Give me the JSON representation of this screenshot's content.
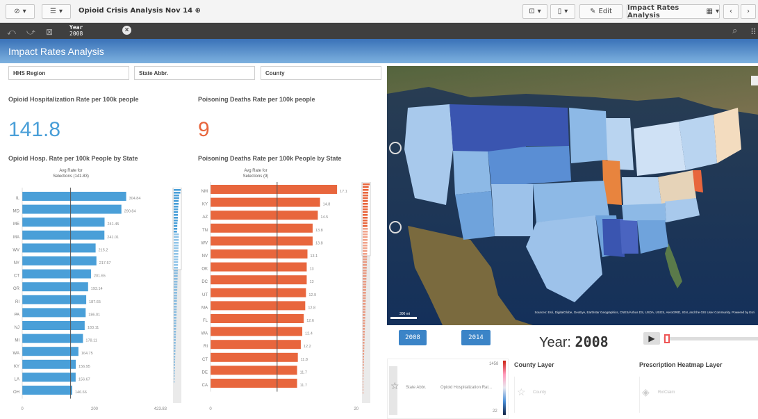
{
  "app": {
    "title": "Opioid Crisis Analysis Nov 14",
    "sheet_title": "Impact Rates Analysis"
  },
  "toolbar": {
    "edit_label": "Edit",
    "sheet_selector": "Impact Rates Analysis"
  },
  "selection": {
    "field": "Year",
    "value": "2008"
  },
  "filters": [
    {
      "label": "HHS Region"
    },
    {
      "label": "State Abbr."
    },
    {
      "label": "County"
    }
  ],
  "kpis": {
    "hosp": {
      "title": "Opioid Hospitalization Rate per 100k people",
      "value": "141.8",
      "color": "#4a9fd8"
    },
    "pois": {
      "title": "Poisoning Deaths Rate per 100k people",
      "value": "9",
      "color": "#e8663d"
    }
  },
  "chart_data": [
    {
      "type": "bar",
      "orientation": "horizontal",
      "title": "Opioid Hosp. Rate per 100k People by State",
      "reference_label": "Avg Rate for Selections (141.83)",
      "reference_value": 141.83,
      "categories": [
        "IL",
        "MD",
        "ME",
        "MA",
        "WV",
        "NY",
        "CT",
        "OR",
        "RI",
        "PA",
        "NJ",
        "MI",
        "WA",
        "KY",
        "LA",
        "OH"
      ],
      "values": [
        304.84,
        290.84,
        241.45,
        241.01,
        215.2,
        217.57,
        201.65,
        193.14,
        187.65,
        186.01,
        183.11,
        178.11,
        164.75,
        156.95,
        156.67,
        146.66
      ],
      "value_labels": [
        "304.84",
        "290.84",
        "241.45",
        "241.01",
        "215.2",
        "217.57",
        "201.65",
        "193.14",
        "187.65",
        "186.01",
        "183.11",
        "178.11",
        "164.75",
        "156.95",
        "156.67",
        "146.66"
      ],
      "xlim": [
        0,
        423.83
      ],
      "xticks": [
        "0",
        "200",
        "423.83"
      ],
      "color": "#4a9fd8"
    },
    {
      "type": "bar",
      "orientation": "horizontal",
      "title": "Poisoning Deaths Rate per 100k People by State",
      "reference_label": "Avg Rate for Selections (9)",
      "reference_value": 9,
      "categories": [
        "NM",
        "KY",
        "AZ",
        "TN",
        "WV",
        "NV",
        "OK",
        "DC",
        "UT",
        "MA",
        "FL",
        "WA",
        "RI",
        "CT",
        "DE",
        "CA"
      ],
      "values": [
        17.1,
        14.8,
        14.5,
        13.8,
        13.8,
        13.1,
        13,
        13,
        12.9,
        12.8,
        12.6,
        12.4,
        12.2,
        11.8,
        11.7,
        11.7
      ],
      "value_labels": [
        "17.1",
        "14.8",
        "14.5",
        "13.8",
        "13.8",
        "13.1",
        "13",
        "13",
        "12.9",
        "12.8",
        "12.6",
        "12.4",
        "12.2",
        "11.8",
        "11.7",
        "11.7"
      ],
      "xlim": [
        0,
        20
      ],
      "xticks": [
        "0",
        "20"
      ],
      "color": "#e8663d"
    }
  ],
  "map": {
    "attribution": "Sources: Esri, DigitalGlobe, GeoEye, Earthstar Geographics, CNES/Airbus DS, USDA, USGS, AeroGRID, IGN, and the GIS User Community. Powered by Esri",
    "scale": "300 mi"
  },
  "years": {
    "start": "2008",
    "end": "2014",
    "current_label": "Year:",
    "current": "2008"
  },
  "legend": {
    "max": "1458",
    "min": "22",
    "col1": "State Abbr.",
    "col2": "Opioid Hospitalization Rat..."
  },
  "layers": {
    "county": "County Layer",
    "county_item": "County",
    "rx": "Prescription Heatmap Layer",
    "rx_item": "Rx/Claim"
  },
  "colors": {
    "blue": "#4a9fd8",
    "orange": "#e8663d",
    "header": "#3f3f3f"
  }
}
